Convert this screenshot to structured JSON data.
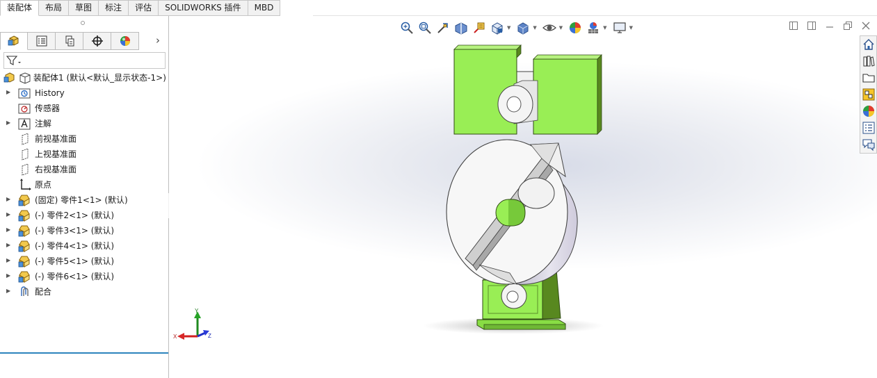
{
  "tabs": [
    {
      "label": "装配体",
      "active": true
    },
    {
      "label": "布局"
    },
    {
      "label": "草图"
    },
    {
      "label": "标注"
    },
    {
      "label": "评估"
    },
    {
      "label": "SOLIDWORKS 插件"
    },
    {
      "label": "MBD"
    }
  ],
  "feature_tree": {
    "root": "装配体1  (默认<默认_显示状态-1>)",
    "items": [
      {
        "label": "History",
        "expandable": true,
        "icon": "history-icon"
      },
      {
        "label": "传感器",
        "expandable": false,
        "icon": "sensor-icon"
      },
      {
        "label": "注解",
        "expandable": true,
        "icon": "annotation-icon"
      },
      {
        "label": "前视基准面",
        "expandable": false,
        "icon": "plane-icon"
      },
      {
        "label": "上视基准面",
        "expandable": false,
        "icon": "plane-icon"
      },
      {
        "label": "右视基准面",
        "expandable": false,
        "icon": "plane-icon"
      },
      {
        "label": "原点",
        "expandable": false,
        "icon": "origin-icon"
      },
      {
        "label": "(固定) 零件1<1> (默认)",
        "expandable": true,
        "icon": "part-icon"
      },
      {
        "label": "(-) 零件2<1> (默认)",
        "expandable": true,
        "icon": "part-icon"
      },
      {
        "label": "(-) 零件3<1> (默认)",
        "expandable": true,
        "icon": "part-icon"
      },
      {
        "label": "(-) 零件4<1> (默认)",
        "expandable": true,
        "icon": "part-icon"
      },
      {
        "label": "(-) 零件5<1> (默认)",
        "expandable": true,
        "icon": "part-icon"
      },
      {
        "label": "(-) 零件6<1> (默认)",
        "expandable": true,
        "icon": "part-icon"
      },
      {
        "label": "配合",
        "expandable": true,
        "icon": "mates-icon"
      }
    ]
  },
  "triad": {
    "x": "X",
    "y": "Y",
    "z": "Z"
  },
  "colors": {
    "accent": "#2d84bd",
    "part_green": "#99ee55",
    "part_white": "#f6f6f6"
  }
}
